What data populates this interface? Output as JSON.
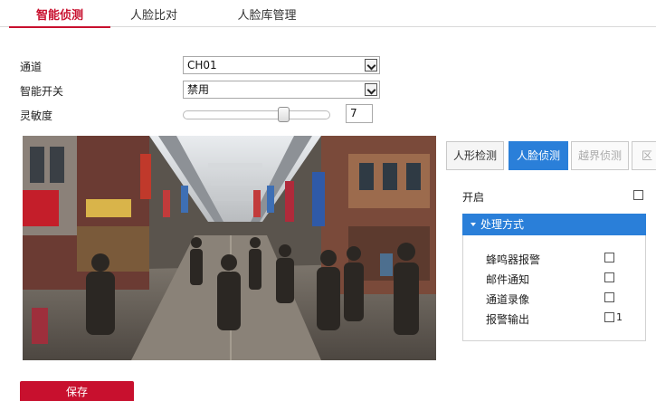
{
  "tabs": [
    {
      "label": "智能侦测"
    },
    {
      "label": "人脸比对"
    },
    {
      "label": "人脸库管理"
    }
  ],
  "form": {
    "channel_label": "通道",
    "channel_value": "CH01",
    "switch_label": "智能开关",
    "switch_value": "禁用",
    "sensitivity_label": "灵敏度",
    "sensitivity_value": "7",
    "sensitivity_level": 0.7
  },
  "detection_tabs": [
    {
      "label": "人形检测"
    },
    {
      "label": "人脸侦测"
    },
    {
      "label": "越界侦测"
    },
    {
      "label": "区域"
    }
  ],
  "settings": {
    "enable_label": "开启",
    "method_title": "处理方式",
    "methods": [
      {
        "label": "蜂鸣器报警"
      },
      {
        "label": "邮件通知"
      },
      {
        "label": "通道录像"
      },
      {
        "label": "报警输出"
      }
    ],
    "alarm_output_number": "1"
  },
  "save_label": "保存",
  "colors": {
    "brand_red": "#c8102e",
    "accent_blue": "#2a7fd9"
  },
  "icons": {
    "dropdown": "chevron-down-icon",
    "method_toggle": "caret-down-icon"
  }
}
